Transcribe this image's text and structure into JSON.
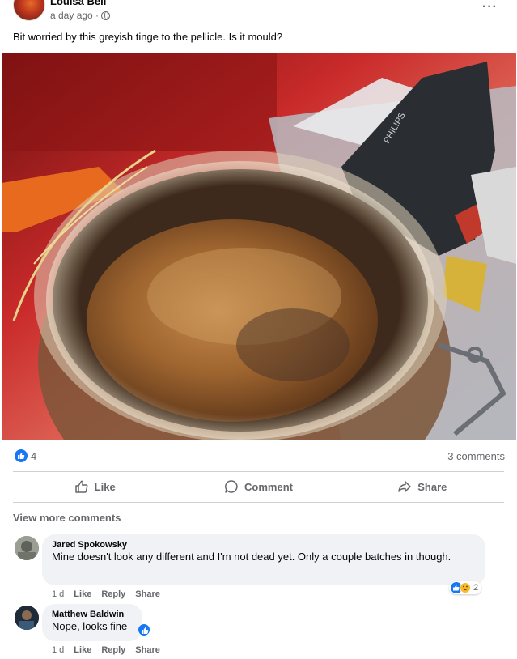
{
  "post": {
    "author": "Louisa Bell",
    "time": "a day ago ·",
    "caption": "Bit worried by this greyish tinge to the pellicle. Is it mould?",
    "photo_brand": "PHILIPS"
  },
  "stats": {
    "likes": "4",
    "comments": "3 comments"
  },
  "actions": {
    "like": "Like",
    "comment": "Comment",
    "share": "Share"
  },
  "view_more": "View more comments",
  "comments": [
    {
      "name": "Jared Spokowsky",
      "text": "Mine doesn't look any different and I'm not dead yet. Only a couple batches in though.",
      "time": "1 d",
      "like": "Like",
      "reply": "Reply",
      "share": "Share",
      "reaction_count": "2"
    },
    {
      "name": "Matthew Baldwin",
      "text": "Nope, looks fine",
      "time": "1 d",
      "like": "Like",
      "reply": "Reply",
      "share": "Share"
    }
  ],
  "colors": {
    "accent": "#1877f2",
    "muted": "#65676b",
    "bubble": "#f0f2f5"
  }
}
